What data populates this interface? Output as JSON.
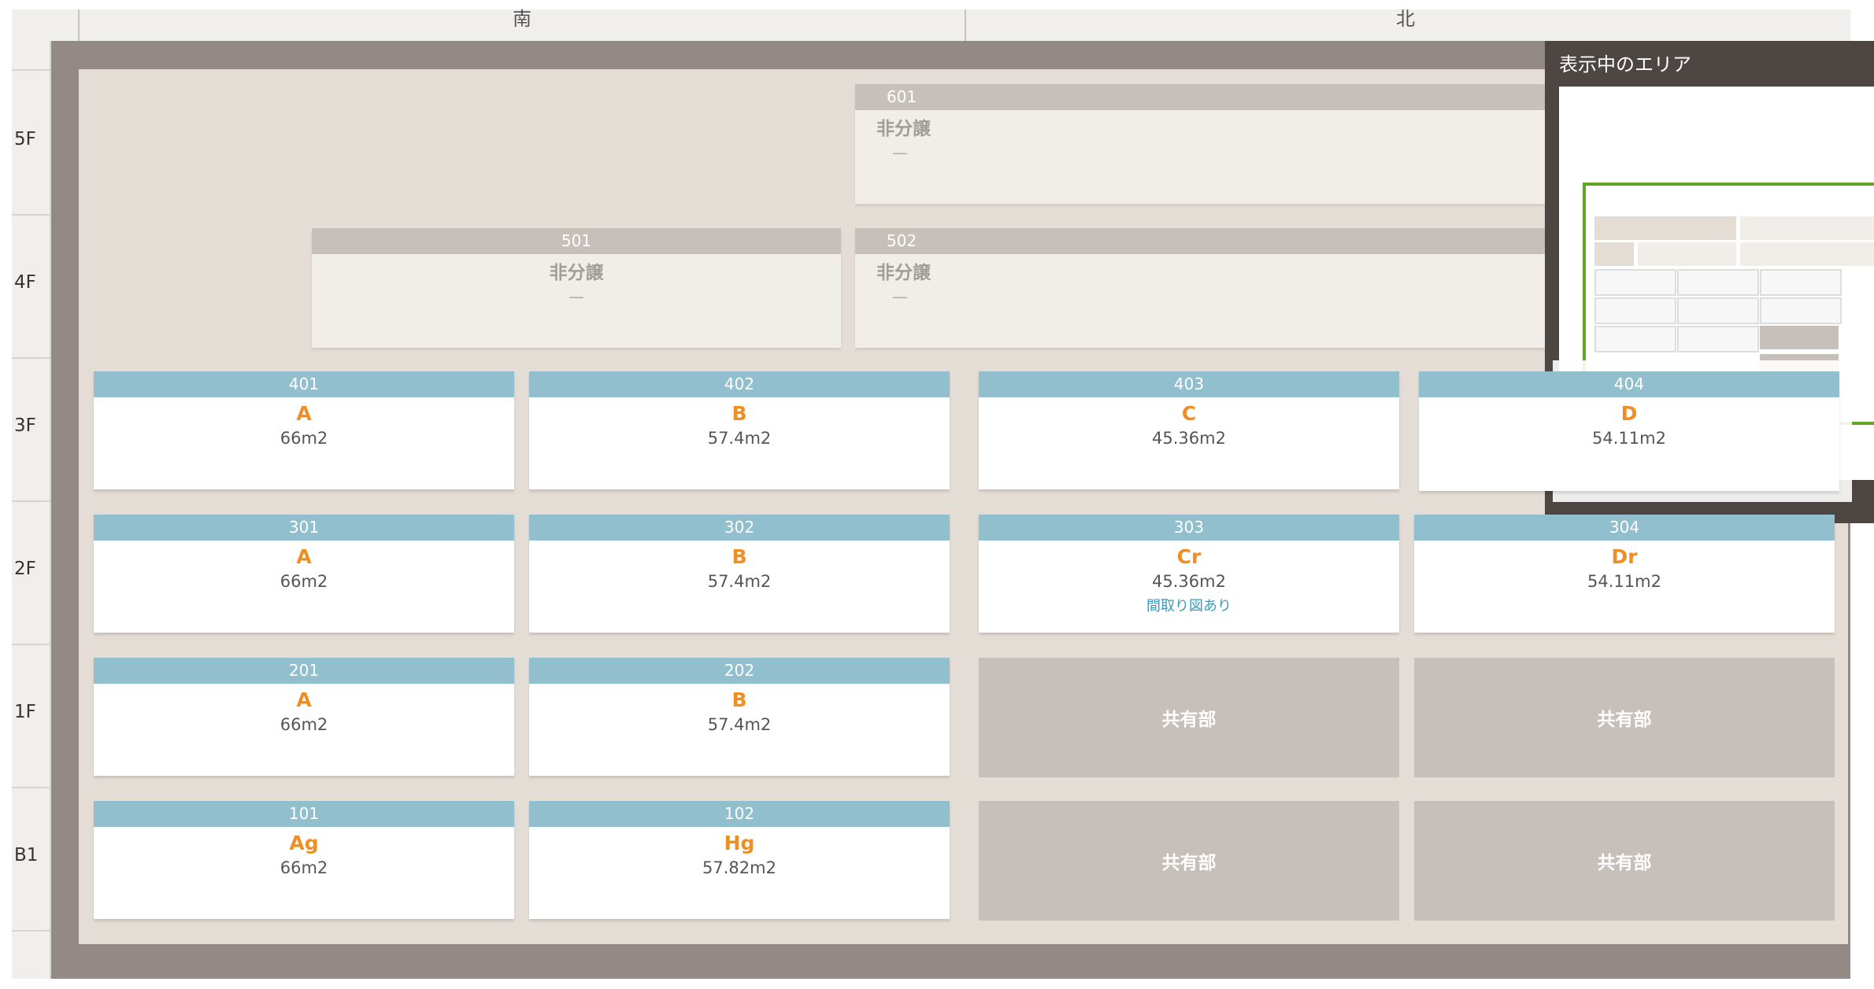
{
  "directions": {
    "south": "南",
    "north": "北"
  },
  "floors": [
    "5F",
    "4F",
    "3F",
    "2F",
    "1F",
    "B1"
  ],
  "minimap": {
    "title": "表示中のエリア"
  },
  "non_sale_units": [
    {
      "number": "601",
      "status": "非分譲",
      "dash": "—"
    },
    {
      "number": "501",
      "status": "非分譲",
      "dash": "—"
    },
    {
      "number": "502",
      "status": "非分譲",
      "dash": "—"
    }
  ],
  "units": [
    {
      "number": "401",
      "type": "A",
      "area": "66m2"
    },
    {
      "number": "402",
      "type": "B",
      "area": "57.4m2"
    },
    {
      "number": "403",
      "type": "C",
      "area": "45.36m2"
    },
    {
      "number": "404",
      "type": "D",
      "area": "54.11m2"
    },
    {
      "number": "301",
      "type": "A",
      "area": "66m2"
    },
    {
      "number": "302",
      "type": "B",
      "area": "57.4m2"
    },
    {
      "number": "303",
      "type": "Cr",
      "area": "45.36m2",
      "link": "間取り図あり"
    },
    {
      "number": "304",
      "type": "Dr",
      "area": "54.11m2"
    },
    {
      "number": "201",
      "type": "A",
      "area": "66m2"
    },
    {
      "number": "202",
      "type": "B",
      "area": "57.4m2"
    },
    {
      "number": "101",
      "type": "Ag",
      "area": "66m2"
    },
    {
      "number": "102",
      "type": "Hg",
      "area": "57.82m2"
    }
  ],
  "common_area_label": "共有部",
  "colors": {
    "unit_header": "#92bfcd",
    "unit_type": "#ef8f23",
    "non_sale_header": "#c7bfba",
    "frame": "#938a86",
    "minimap_view_box": "#5ea624"
  }
}
